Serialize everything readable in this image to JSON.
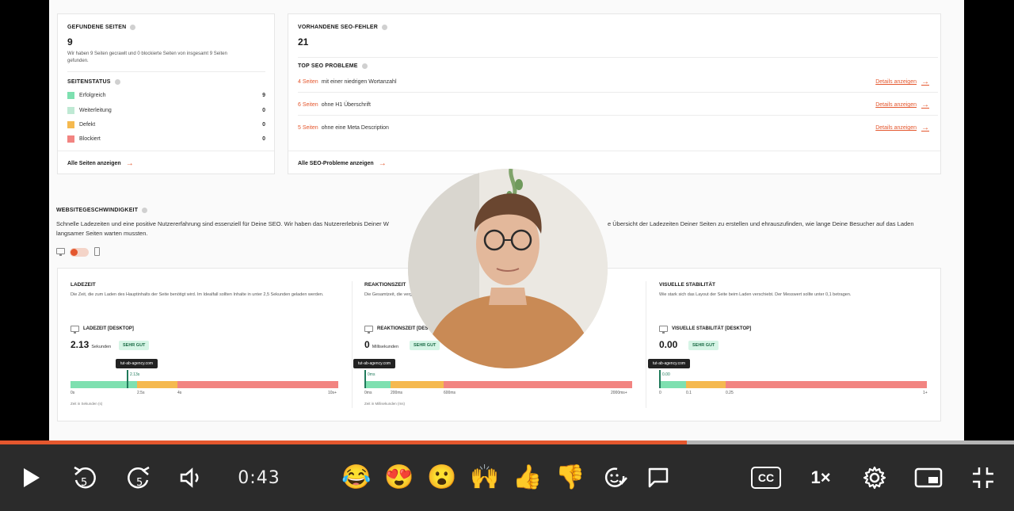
{
  "pages": {
    "title": "GEFUNDENE SEITEN",
    "count": "9",
    "summary": "Wir haben 9 Seiten gecrawlt und 0 blockierte Seiten von insgesamt 9 Seiten gefunden.",
    "status_title": "SEITENSTATUS",
    "status": [
      {
        "label": "Erfolgreich",
        "count": "9",
        "color": "#7ee0b0"
      },
      {
        "label": "Weiterleitung",
        "count": "0",
        "color": "#bfe9d4"
      },
      {
        "label": "Defekt",
        "count": "0",
        "color": "#f5b94f"
      },
      {
        "label": "Blockiert",
        "count": "0",
        "color": "#f28481"
      }
    ],
    "all_link": "Alle Seiten anzeigen"
  },
  "seo": {
    "title": "VORHANDENE SEO-FEHLER",
    "count": "21",
    "top_title": "TOP SEO PROBLEME",
    "issues": [
      {
        "num": "4 Seiten",
        "text": "mit einer niedrigen Wortanzahl",
        "details": "Details anzeigen"
      },
      {
        "num": "6 Seiten",
        "text": "ohne H1 Überschrift",
        "details": "Details anzeigen"
      },
      {
        "num": "5 Seiten",
        "text": "ohne eine Meta Description",
        "details": "Details anzeigen"
      }
    ],
    "all_link": "Alle SEO-Probleme anzeigen"
  },
  "speed": {
    "title": "WEBSITEGESCHWINDIGKEIT",
    "desc_line1": "Schnelle Ladezeiten und eine positive Nutzererfahrung sind essenziell für Deine SEO. Wir haben das Nutzererlebnis Deiner W",
    "desc_line1b": "e Übersicht der Ladezeiten Deiner Seiten zu erstellen und ehrauszufinden, wie lange Deine Besucher auf das Laden",
    "desc_line2": "langsamer Seiten warten mussten.",
    "columns": [
      {
        "title": "LADEZEIT",
        "explain": "Die Zeit, die zum Laden des Hauptinhalts der Seite benötigt wird. Im Idealfall sollten Inhalte in unter 2,5 Sekunden geladen werden.",
        "metric": "LADEZEIT [DESKTOP]",
        "value": "2.13",
        "unit": "Sekunden",
        "badge": "SEHR GUT",
        "tooltip": "tut-ab-agency.com",
        "marker_label": "2.13s",
        "marker_pos": 0.213,
        "ticks": [
          "0s",
          "2.5s",
          "4s",
          "10s+"
        ],
        "axis_note": "Zeit in Sekunden (s)"
      },
      {
        "title": "REAKTIONSZEIT",
        "explain": "Die Gesamtzeit, die vergeht, bis die Seite auf eine Eingabe reagieren kann. Eine ideale Geschwindigkeit",
        "metric": "REAKTIONSZEIT [DESKTOP]",
        "value": "0",
        "unit": "Millisekunden",
        "badge": "SEHR GUT",
        "tooltip": "tut-ab-agency.com",
        "marker_label": "0ms",
        "marker_pos": 0.0,
        "ticks": [
          "0ms",
          "200ms",
          "600ms",
          "2000ms+"
        ],
        "axis_note": "Zeit in Millisekunden (ms)"
      },
      {
        "title": "VISUELLE STABILITÄT",
        "explain": "Wie stark sich das Layout der Seite beim Laden verschiebt. Der Messwert sollte unter 0,1 betragen.",
        "metric": "VISUELLE STABILITÄT [DESKTOP]",
        "value": "0.00",
        "unit": "",
        "badge": "SEHR GUT",
        "tooltip": "tut-ab-agency.com",
        "marker_label": "0.00",
        "marker_pos": 0.0,
        "ticks": [
          "0",
          "0.1",
          "0.25",
          "1+"
        ],
        "axis_note": ""
      }
    ]
  },
  "player": {
    "time": "0:43",
    "speed": "1×",
    "cc": "CC",
    "progress": 0.677,
    "reactions": [
      "😂",
      "😍",
      "😮",
      "🙌",
      "👍",
      "👎"
    ],
    "accent": "#e4572e"
  }
}
